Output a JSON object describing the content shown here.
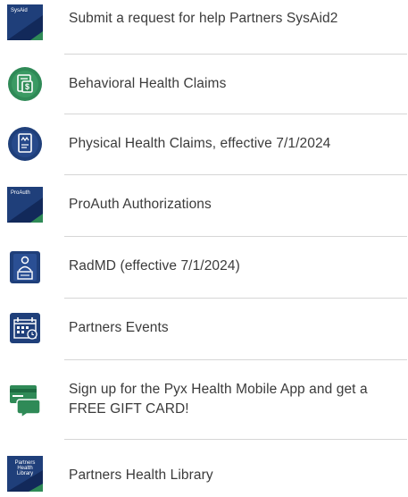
{
  "colors": {
    "navy": "#1f3f7a",
    "navy_dark": "#12295a",
    "green": "#2f8a57",
    "green_dark": "#1d6b41",
    "text": "#3b3b3b",
    "divider": "#d6d6d6"
  },
  "items": [
    {
      "label": "Submit a request for help Partners SysAid2",
      "icon": "sysaid-icon",
      "icon_text": "SysAid"
    },
    {
      "label": "Behavioral Health Claims",
      "icon": "behavioral-claims-icon"
    },
    {
      "label": "Physical Health Claims, effective 7/1/2024",
      "icon": "physical-claims-icon"
    },
    {
      "label": "ProAuth Authorizations",
      "icon": "proauth-icon",
      "icon_text": "ProAuth"
    },
    {
      "label": "RadMD (effective 7/1/2024)",
      "icon": "radmd-icon"
    },
    {
      "label": "Partners Events",
      "icon": "calendar-icon"
    },
    {
      "label": "Sign up for the Pyx Health Mobile App and get a FREE GIFT CARD!",
      "icon": "gift-card-chat-icon"
    },
    {
      "label": "Partners Health Library",
      "icon": "health-library-icon",
      "icon_text_lines": [
        "Partners",
        "Health",
        "Library"
      ]
    }
  ]
}
